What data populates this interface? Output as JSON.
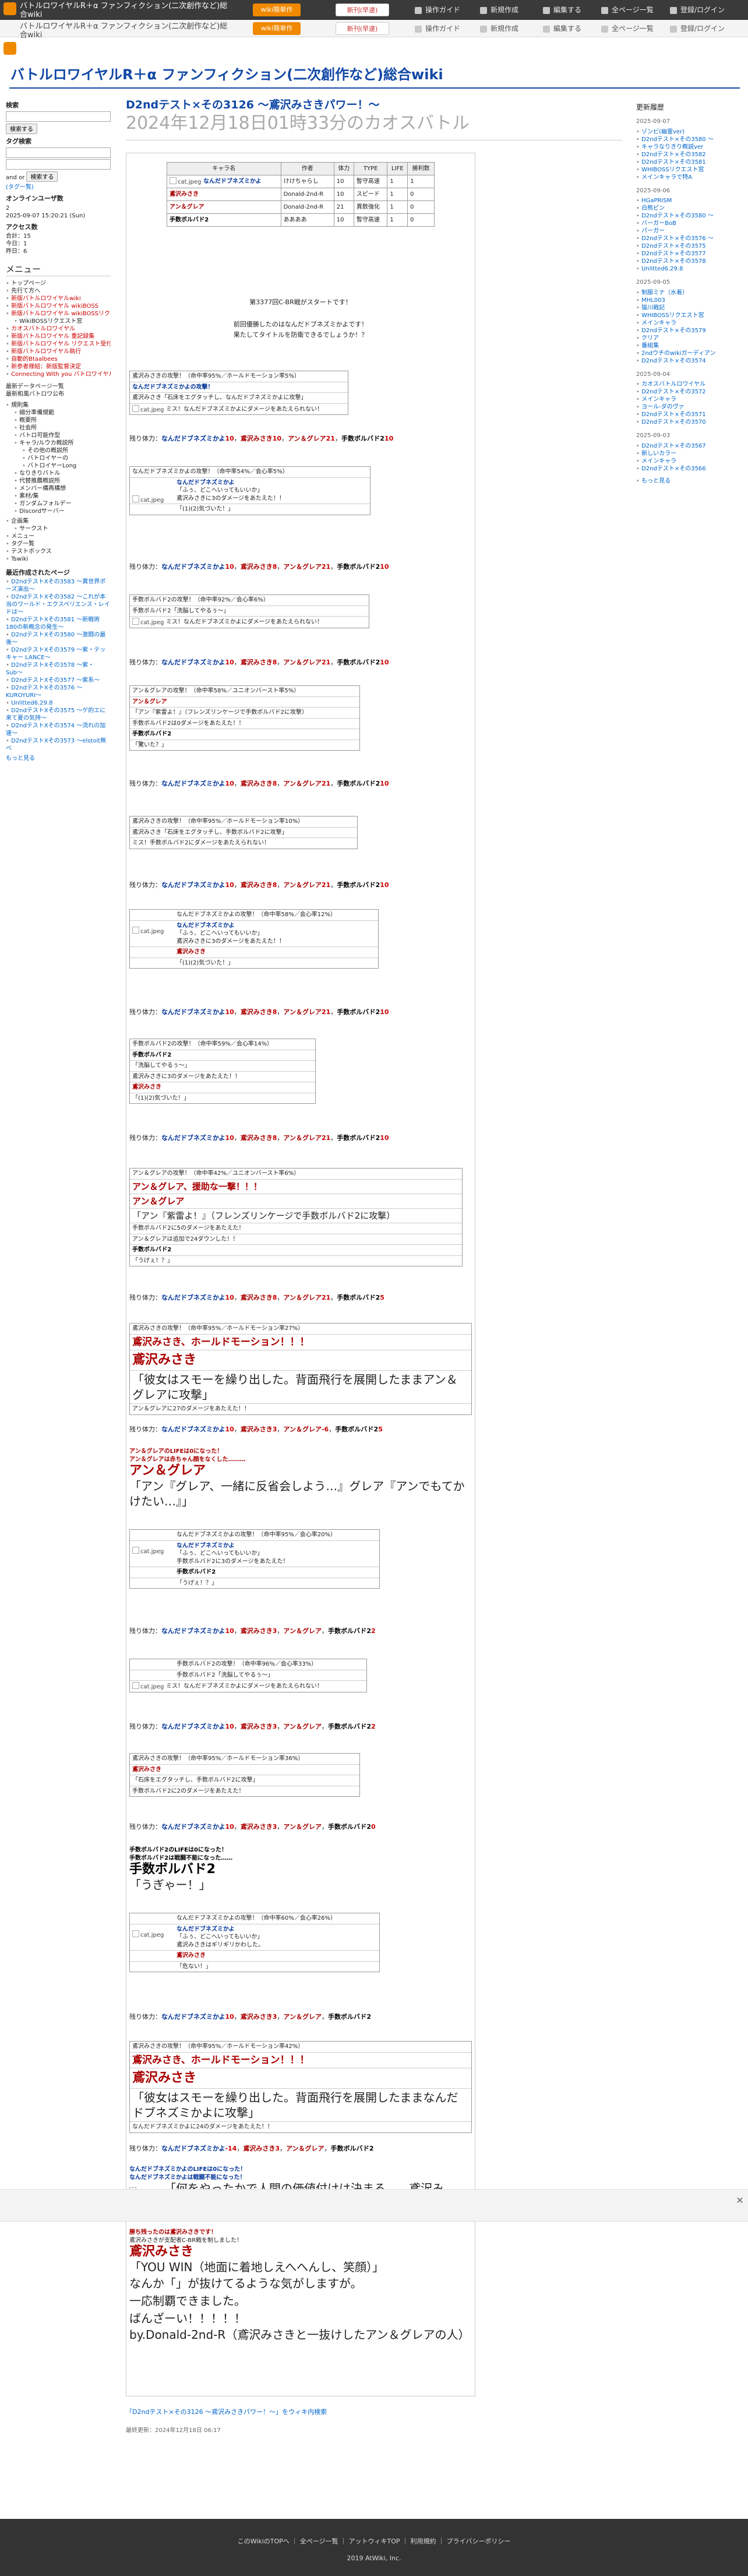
{
  "topbar": {
    "title": "バトルロワイヤルR＋α ファンフィクション(二次創作など)総合wiki",
    "btn1": "wiki簡単作",
    "btn2": "新刊(早速)",
    "link1": "操作ガイド",
    "link2": "新規作成",
    "link3": "編集する",
    "link4": "全ページ一覧",
    "link5": "登録/ログイン"
  },
  "site": {
    "title": "バトルロワイヤルR＋α ファンフィクション(二次創作など)総合wiki"
  },
  "page": {
    "subtitle": "D2ndテスト×その3126 〜鳶沢みさきパワー！〜",
    "title": "2024年12月18日01時33分のカオスバトル"
  },
  "left": {
    "search_h": "検索",
    "search_btn": "検索する",
    "adv_h": "タグ検索",
    "and": "and",
    "or": "or",
    "search_btn2": "検索する",
    "tag_note": "(タグ一覧)",
    "online_h": "オンラインユーザ数",
    "online_val": "2",
    "online_time": "2025-09-07 15:20:21 (Sun)",
    "access_h": "アクセス数",
    "total": "合計：15",
    "today": "今日：1",
    "yesterday": "昨日：6",
    "menu_h": "メニュー",
    "menu": [
      "トップページ",
      "先行て方へ",
      "新版バトルロワイヤルwiki",
      "新版バトルロワイヤル wikiBOSS",
      "新版バトルロワイヤル wikiBOSSリクエスト窓",
      "WikiBOSSリクエスト窓",
      "カオスバトルロワイヤル",
      "新版バトルロワイヤル 重記録集",
      "新版バトルロワイヤル リクエスト受付",
      "新版バトルロワイヤル執行",
      "自動的Btaalbees",
      "新参者様紹：新版監督決定",
      "Connecting With you バトロワイヤル！"
    ],
    "recent_hint": "最新データページ一覧",
    "recent_hint2": "最新和風バトロワ公布",
    "tree": [
      "規則集",
      "細分準備規範",
      "概要所",
      "社会所",
      "バトロ可能作型",
      "キャラ/ルウカ概説所",
      "その他の概説所",
      "バトロイヤーの",
      "バトロイヤーLong",
      "なりきりバトル",
      "代替推薦概説所",
      "メンバー構再構想",
      "素材/集",
      "ガンダムフォルデー",
      "Discordサーバー"
    ],
    "misc": [
      "企画集",
      "サークスト",
      "メニュー",
      "タグ一覧",
      "テストボックス",
      "Tswiki"
    ],
    "recent_h": "最近作成されたページ",
    "recent": [
      "D2ndテストXその3583 〜異世界ポーズ演出〜",
      "D2ndテストXその3582 〜これが本当のワールド・エクスペリエンス・レイドは〜",
      "D2ndテストXその3581 〜新戦術180の新概念の発生〜",
      "D2ndテストXその3580 〜激闘の最後〜",
      "D2ndテストXその3579 〜紫・テッキャー LANCE〜",
      "D2ndテストXその3578 〜紫・Sub〜",
      "D2ndテストXその3577 〜紫系〜",
      "D2ndテストXその3576 〜KUROYURI〜",
      "Unlitted6.29.8",
      "D2ndテストXその3575 〜ゲ的エに来て夏の気持〜",
      "D2ndテストXその3574 〜流れの加速〜",
      "D2ndテストXその3573 〜elstoit無べ"
    ],
    "more": "もっと見る"
  },
  "right": {
    "h": "更新履歴",
    "groups": [
      {
        "date": "2025-09-07",
        "items": [
          "ゾンビ(幽霊ver)",
          "D2ndテスト×その3580 〜",
          "キャラなりきり概説ver",
          "D2ndテスト×その3582",
          "D2ndテスト×その3581",
          "WHIBOSSリクエスト窓",
          "メインキャラで特A"
        ]
      },
      {
        "date": "2025-09-06",
        "items": [
          "HGaPRISM",
          "白熊ピン",
          "D2ndテスト×その3580 〜",
          "バーガーBoB",
          "パーガー",
          "D2ndテスト×その3576 〜",
          "D2ndテスト×その3575",
          "D2ndテスト×その3577",
          "D2ndテスト×その3578",
          "Unlitted6.29.8"
        ]
      },
      {
        "date": "2025-09-05",
        "items": [
          "制服ミナ（水着）",
          "MHL003",
          "猫川戦記",
          "WHIBOSSリクエスト窓",
          "メインキャラ",
          "D2ndテスト×その3579",
          "クリア",
          "番組集",
          "2ndウチのwikiガーディアン",
          "D2ndテスト×その3574"
        ]
      },
      {
        "date": "2025-09-04",
        "items": [
          "カオスバトルロワイヤル",
          "D2ndテスト×その3572",
          "メインキャラ",
          "ヨール-ダのヴァ",
          "D2ndテスト×その3571",
          "D2ndテスト×その3570"
        ]
      },
      {
        "date": "2025-09-03",
        "items": [
          "D2ndテスト×その3567",
          "新しいカラー",
          "メインキャラ",
          "D2ndテスト×その3566"
        ]
      }
    ],
    "more": "もっと見る"
  },
  "table": {
    "headers": [
      "キャラ名",
      "作者",
      "体力",
      "TYPE",
      "LIFE",
      "勝利数"
    ],
    "rows": [
      [
        "なんだドブネズミかよ",
        "けけちゃらし",
        "10",
        "暫守高速",
        "1",
        "1"
      ],
      [
        "鳶沢みさき",
        "Donald-2nd-R",
        "10",
        "スピード",
        "1",
        "0"
      ],
      [
        "アン＆グレア",
        "Donald-2nd-R",
        "21",
        "異数強化",
        "1",
        "0"
      ],
      [
        "手数ボルバド2",
        "ああああ",
        "10",
        "暫守高速",
        "1",
        "0"
      ]
    ]
  },
  "intro": {
    "l1": "第3377回C-BR戦がスタートです！",
    "l2": "前回優勝したのはなんだドブネズミかよです！",
    "l3": "果たしてタイトルを防衛できるでしょうか！？"
  },
  "img": "cat.jpeg",
  "remaining": [
    {
      "a": "10",
      "b": "10",
      "c": "21",
      "d": "10"
    },
    {
      "a": "10",
      "b": "8",
      "c": "21",
      "d": "10"
    },
    {
      "a": "10",
      "b": "8",
      "c": "21",
      "d": "10"
    },
    {
      "a": "10",
      "b": "8",
      "c": "21",
      "d": "10"
    },
    {
      "a": "10",
      "b": "8",
      "c": "21",
      "d": "10"
    },
    {
      "a": "10",
      "b": "8",
      "c": "21",
      "d": "10"
    },
    {
      "a": "10",
      "b": "8",
      "c": "21",
      "d": "10"
    },
    {
      "a": "10",
      "b": "8",
      "c": "21",
      "d": "5"
    },
    {
      "a": "10",
      "b": "3",
      "c": "-6",
      "d": "5"
    },
    {
      "a": "10",
      "b": "3",
      "c": "",
      "d": "2"
    },
    {
      "a": "10",
      "b": "3",
      "c": "",
      "d": "2"
    },
    {
      "a": "10",
      "b": "3",
      "c": "",
      "d": "0"
    },
    {
      "a": "10",
      "b": "3",
      "c": "",
      "d": ""
    },
    {
      "a": "-14",
      "b": "3",
      "c": "",
      "d": ""
    }
  ],
  "ev": {
    "e1a": "鳶沢みさきの攻撃！（命中率95%／ホールドモーション率5%）",
    "e1b": "なんだドブネズミかよの攻撃！",
    "e1c": "鳶沢みさき「石床をエグタッチし、なんだドブネズミかよに攻撃」",
    "e1d": "ミス！なんだドブネズミかよにダメージをあたえられない！",
    "e2a": "なんだドブネズミかよの攻撃！（命中率54%／会心率5%）",
    "e2b": "なんだドブネズミかよ",
    "e2c": "「ふぅ、どこへいってもいいか」",
    "e2d": "鳶沢みさきに3のダメージをあたえた！！",
    "e2e": "「(1)(2)気づいた！」",
    "e3a": "手数ボルバド2の攻撃！（命中率92%／会心率6%）",
    "e3b": "手数ボルバド2「洗脳してやるぅ〜」",
    "e3c": "ミス！なんだドブネズミかよにダメージをあたえられない！",
    "e4a": "アン＆グレアの攻撃！（命中率58%／ユニオンバースト率5%）",
    "e4b": "アン＆グレア",
    "e4c": "「アン『紫雷よ！』（フレンズリンケージで手数ボルバド2に攻撃）",
    "e4d": "手数ボルバド2は0ダメージをあたえた！！",
    "e4e": "手数ボルバド2",
    "e4f": "「驚いた？」",
    "e5a": "鳶沢みさきの攻撃！（命中率95%／ホールドモーション率10%）",
    "e5b": "鳶沢みさき「石床をエグタッチし、手数ボルバド2に攻撃」",
    "e5c": "ミス！手数ボルバド2にダメージをあたえられない！",
    "e6a": "なんだドブネズミかよの攻撃！（命中率58%／会心率12%）",
    "e6b": "なんだドブネズミかよ",
    "e6c": "「ふぅ、どこへいってもいいか」",
    "e6d": "鳶沢みさきに3のダメージをあたえた！！",
    "e6e": "鳶沢みさき",
    "e6f": "「(1)(2)気づいた！」",
    "e7a": "手数ボルバド2の攻撃！（命中率59%／会心率14%）",
    "e7b": "手数ボルバド2",
    "e7c": "「洗脳してやるぅ〜」",
    "e7d": "鳶沢みさきに3のダメージをあたえた！！",
    "e7e": "鳶沢みさき",
    "e7f": "「(1)(2)気づいた！」",
    "e8a": "アン＆グレアの攻撃！（命中率42%／ユニオンバースト率6%）",
    "e8b": "アン＆グレア、援助な一撃！！！",
    "e8c": "アン＆グレア",
    "e8d": "「アン『紫雷よ！』（フレンズリンケージで手数ボルバド2に攻撃）",
    "e8e": "手数ボルバド2に5のダメージをあたえた！",
    "e8f": "アン＆グレアは追加で24ダウンした！！",
    "e8g": "手数ボルバド2",
    "e8h": "「うげぇ！？」",
    "e9a": "鳶沢みさきの攻撃！（命中率95%／ホールドモーション率27%）",
    "e9b": "鳶沢みさき、ホールドモーション！！！",
    "e9c": "鳶沢みさき",
    "e9d": "「彼女はスモーを繰り出した。背面飛行を展開したままアン＆グレアに攻撃」",
    "e9e": "アン＆グレアに27のダメージをあたえた！！",
    "e10a": "アン＆グレアのLIFEは0になった！",
    "e10b": "アン＆グレアは赤ちゃん顔をなくした………",
    "e10c": "アン＆グレア",
    "e10d": "「アン『グレア、一緒に反省会しよう…』グレア『アンでもてかけたい…』」",
    "e11a": "なんだドブネズミかよの攻撃！（命中率95%／会心率20%）",
    "e11b": "なんだドブネズミかよ",
    "e11c": "「ふぅ、どこへいってもいいか」",
    "e11d": "手数ボルバド2に3のダメージをあたえた！",
    "e11e": "手数ボルバド2",
    "e11f": "「うげぇ！？」",
    "e12a": "手数ボルバド2の攻撃！（命中率96%／会心率33%）",
    "e12b": "手数ボルバド2「洗脳してやるぅ〜」",
    "e12c": "ミス！なんだドブネズミかよにダメージをあたえられない！",
    "e13a": "鳶沢みさきの攻撃！（命中率95%／ホールドモーション率36%）",
    "e13b": "鳶沢みさき",
    "e13c": "「石床をエグタッチし、手数ボルバド2に攻撃」",
    "e13d": "手数ボルバド2に2のダメージをあたえた！",
    "e14a": "手数ボルバド2のLIFEは0になった！",
    "e14b": "手数ボルバド2は戦闘不能になった……",
    "e14c": "手数ボルバド2",
    "e14d": "「うぎゃー！」",
    "e15a": "なんだドブネズミかよの攻撃！（命中率60%／会心率26%）",
    "e15b": "なんだドブネズミかよ",
    "e15c": "「ふぅ、どこへいってもいいか」",
    "e15d": "鳶沢みさきはギリギリかわした。",
    "e15e": "鳶沢みさき",
    "e15f": "「危ない！」",
    "e16a": "鳶沢みさきの攻撃！（命中率95%／ホールドモーション率42%）",
    "e16b": "鳶沢みさき、ホールドモーション！！！",
    "e16c": "鳶沢みさき",
    "e16d": "「彼女はスモーを繰り出した。背面飛行を展開したままなんだドブネズミかよに攻撃」",
    "e16e": "なんだドブネズミかよに24のダメージをあたえた！！",
    "e17a": "なんだドブネズミかよのLIFEは0になった！",
    "e17b": "なんだドブネズミかよは戦闘不能になった！",
    "e17c": "「何をやったかで人間の価値付けは決まる……鳶沢みさきは強い…」",
    "win1": "勝ち残ったのは鳶沢みさきです！",
    "win2": "鳶沢みさきが支配者C-BR戦を制しました！",
    "win3": "鳶沢みさき",
    "win4": "「YOU WIN（地面に着地しえへへんし、笑顔）」",
    "win5": "なんか「」が抜けてるような気がしますが。",
    "win6": "一応制覇できました。",
    "win7": "ばんざーい！！！！！",
    "win8": "by.Donald-2nd-R（鳶沢みさきと一抜けしたアン＆グレアの人）"
  },
  "label": {
    "remain": "残り体力：",
    "sep": "，"
  },
  "footer": {
    "link": "「D2ndテスト×その3126 〜鳶沢みさきパワー！〜」をウィキ内検索",
    "date": "最終更新：2024年12月18日 06:17",
    "links": "このWikiのTOPへ ｜ 全ページ一覧 ｜ アットウィキTOP ｜ 利用規約 ｜ プライバシーポリシー",
    "copy": "2019 AtWiki, Inc."
  }
}
